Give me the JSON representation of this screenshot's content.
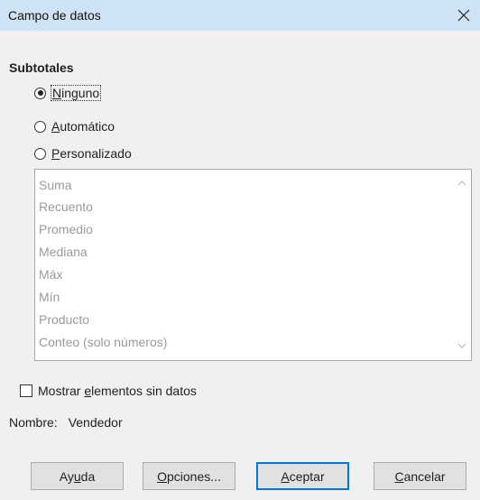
{
  "window": {
    "title": "Campo de datos",
    "close_icon": "close-icon"
  },
  "subtotales": {
    "title": "Subtotales",
    "options": [
      {
        "before": "",
        "key": "N",
        "after": "inguno",
        "checked": true
      },
      {
        "before": "",
        "key": "A",
        "after": "utomático",
        "checked": false
      },
      {
        "before": "",
        "key": "P",
        "after": "ersonalizado",
        "checked": false
      }
    ]
  },
  "functions": [
    "Suma",
    "Recuento",
    "Promedio",
    "Mediana",
    "Máx",
    "Mín",
    "Producto",
    "Conteo (solo números)"
  ],
  "show_empty": {
    "before": "Mostrar ",
    "key": "e",
    "after": "lementos sin datos",
    "checked": false
  },
  "name": {
    "label": "Nombre:",
    "value": "Vendedor"
  },
  "buttons": {
    "help": {
      "before": "Ay",
      "key": "u",
      "after": "da"
    },
    "options": {
      "before": "",
      "key": "O",
      "after": "pciones..."
    },
    "ok": {
      "before": "",
      "key": "A",
      "after": "ceptar"
    },
    "cancel": {
      "before": "",
      "key": "C",
      "after": "ancelar"
    }
  }
}
